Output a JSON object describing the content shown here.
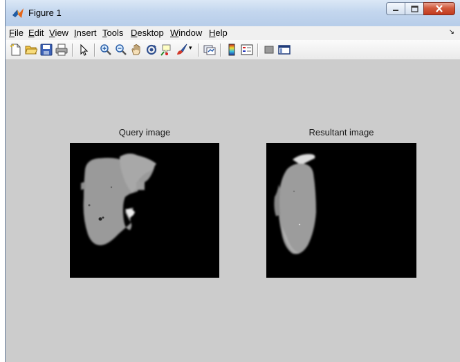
{
  "window": {
    "title": "Figure 1"
  },
  "menu": [
    "File",
    "Edit",
    "View",
    "Insert",
    "Tools",
    "Desktop",
    "Window",
    "Help"
  ],
  "menu_access_keys": [
    "F",
    "E",
    "V",
    "I",
    "T",
    "D",
    "W",
    "H"
  ],
  "toolbar_icons": [
    "new-figure-icon",
    "open-file-icon",
    "save-icon",
    "print-icon",
    "select-arrow-icon",
    "zoom-in-icon",
    "zoom-out-icon",
    "pan-hand-icon",
    "rotate-3d-icon",
    "data-cursor-icon",
    "brush-icon",
    "brush-dropdown-icon",
    "link-plot-icon",
    "colorbar-icon",
    "legend-icon",
    "hide-plot-tools-icon",
    "show-plot-tools-icon"
  ],
  "plots": [
    {
      "title": "Query image"
    },
    {
      "title": "Resultant image"
    }
  ],
  "colors": {
    "figure_background": "#cccccc",
    "axes_background": "#000000",
    "close_button": "#c83c1f"
  }
}
